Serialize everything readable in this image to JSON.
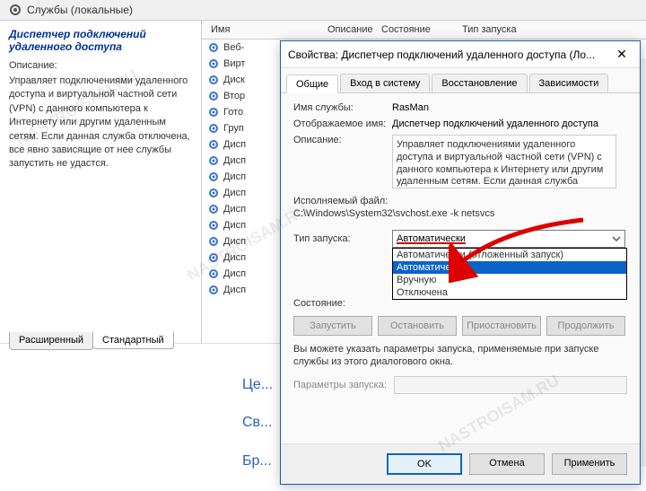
{
  "header": {
    "title": "Службы (локальные)"
  },
  "left": {
    "service_title": "Диспетчер подключений удаленного доступа",
    "desc_label": "Описание:",
    "desc_text": "Управляет подключениями удаленного доступа и виртуальной частной сети (VPN) с данного компьютера к Интернету или другим удаленным сетям. Если данная служба отключена, все явно зависящие от нее службы запустить не удастся."
  },
  "columns": {
    "name": "Имя",
    "desc": "Описание",
    "state": "Состояние",
    "start": "Тип запуска"
  },
  "services": [
    "Веб-клиент",
    "Виртуальный диск",
    "Дисковая подсистема",
    "Вторичный вход",
    "Готовность приложений",
    "Групповая политика",
    "Диспетчер автоматических...",
    "Диспетчер локальных...",
    "Диспетчер печати",
    "Диспетчер подключений",
    "Диспетчер подключений",
    "Диспетчер пользователей",
    "Диспетчер сеансов",
    "Диспетчер скачивания",
    "Диспетчер учетных",
    "Диспетчер учетных"
  ],
  "bottom_tabs": {
    "ext": "Расширенный",
    "std": "Стандартный"
  },
  "teaser": {
    "l1": "Це...",
    "l2": "Св...",
    "l3": "Бр..."
  },
  "dialog": {
    "title": "Свойства: Диспетчер подключений удаленного доступа (Ло...",
    "tabs": {
      "general": "Общие",
      "logon": "Вход в систему",
      "recovery": "Восстановление",
      "deps": "Зависимости"
    },
    "labels": {
      "svc_name": "Имя службы:",
      "disp_name": "Отображаемое имя:",
      "desc": "Описание:",
      "exe_label": "Исполняемый файл:",
      "start_type": "Тип запуска:",
      "state": "Состояние:",
      "params": "Параметры запуска:"
    },
    "vals": {
      "svc_name": "RasMan",
      "disp_name": "Диспетчер подключений удаленного доступа",
      "desc": "Управляет подключениями удаленного доступа и виртуальной частной сети (VPN) с данного компьютера к Интернету или другим удаленным сетям. Если данная служба",
      "exe": "C:\\Windows\\System32\\svchost.exe -k netsvcs",
      "start_selected": "Автоматически",
      "state": ""
    },
    "dd_opts": {
      "delayed": "Автоматически (отложенный запуск)",
      "auto": "Автоматически",
      "manual": "Вручную",
      "disabled": "Отключена"
    },
    "btns": {
      "start": "Запустить",
      "stop": "Остановить",
      "pause": "Приостановить",
      "resume": "Продолжить"
    },
    "note": "Вы можете указать параметры запуска, применяемые при запуске службы из этого диалогового окна.",
    "footer": {
      "ok": "OK",
      "cancel": "Отмена",
      "apply": "Применить"
    }
  }
}
